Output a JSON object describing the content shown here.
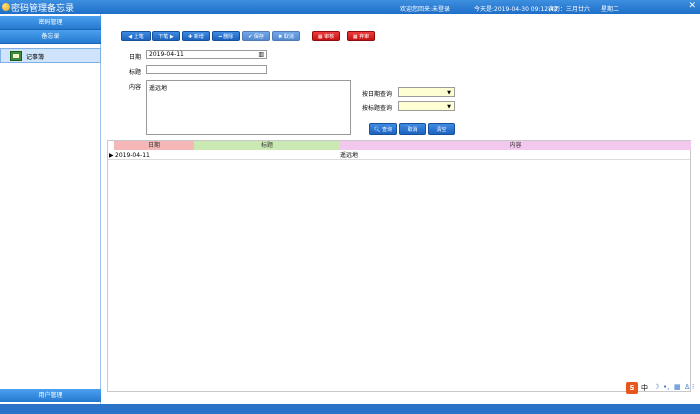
{
  "window": {
    "title": "密码管理备忘录",
    "login_status": "欢迎您回来:未登录",
    "today": "今天是:2019-04-30 09:12:42",
    "lunar": "农历：三月廿六",
    "weekday": "星期二"
  },
  "sidebar": {
    "password_mgmt": "密码管理",
    "memo": "备忘录",
    "items": [
      {
        "label": "记事簿"
      }
    ],
    "user_mgmt": "用户管理"
  },
  "toolbar": {
    "prev": "◀ 上笔",
    "next": "下笔 ▶",
    "add": "✚ 新增",
    "delete": "━ 删除",
    "save": "✔ 保存",
    "cancel": "✖ 取消",
    "review": "▦ 审核",
    "unreview": "▦ 弃审"
  },
  "form": {
    "date_label": "日期",
    "date_value": "2019-04-11",
    "title_label": "标题",
    "title_value": "",
    "content_label": "内容",
    "content_value": "遥远地",
    "search_by_date_label": "按日期查询",
    "search_by_title_label": "按标题查询",
    "query_button": "查询",
    "cancel_button": "取消",
    "clear_button": "清空"
  },
  "grid": {
    "columns": [
      "日期",
      "标题",
      "内容"
    ],
    "rows": [
      {
        "date": "2019-04-11",
        "title": "",
        "content": "遥远地"
      }
    ]
  },
  "ime": {
    "brand": "S",
    "mode": "中"
  },
  "colors": {
    "header_date": "#f5b7b7",
    "header_title": "#cbeab3",
    "header_content": "#f3c8ee",
    "accent_blue": "#2579d0",
    "accent_red": "#d31c1c"
  }
}
